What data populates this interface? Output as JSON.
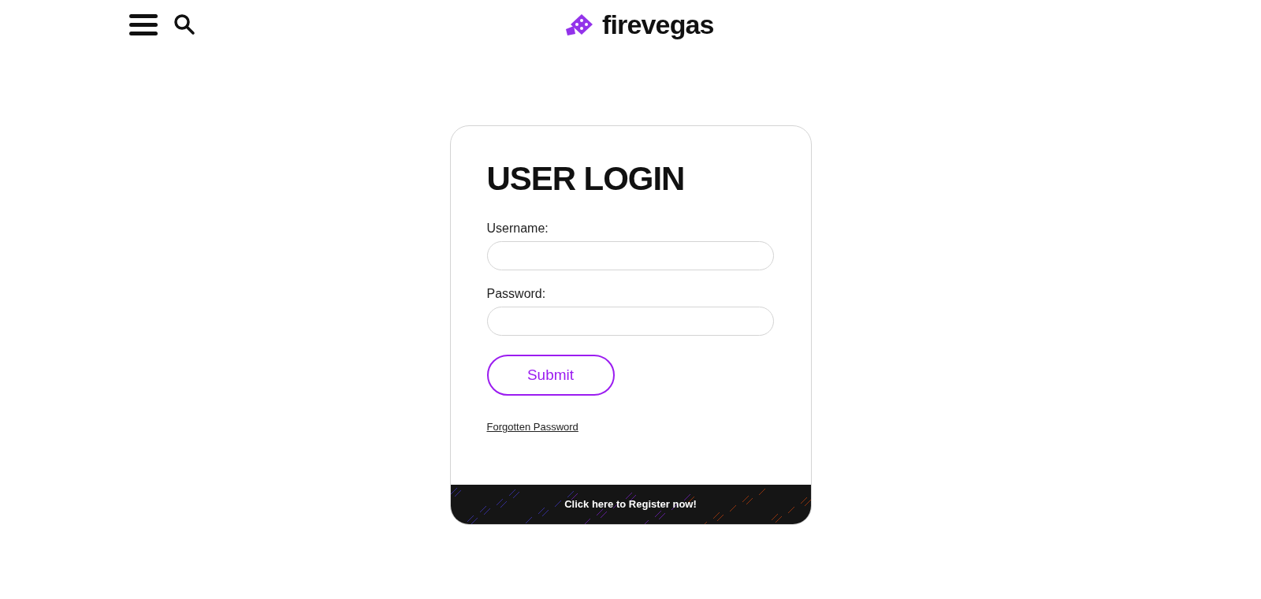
{
  "header": {
    "logo": "firevegas"
  },
  "login": {
    "title": "USER LOGIN",
    "fields": [
      {
        "label": "Username:"
      },
      {
        "label": "Password:"
      }
    ],
    "submit": "Submit",
    "forgot": "Forgotten Password",
    "register": "Click here to Register now!"
  }
}
